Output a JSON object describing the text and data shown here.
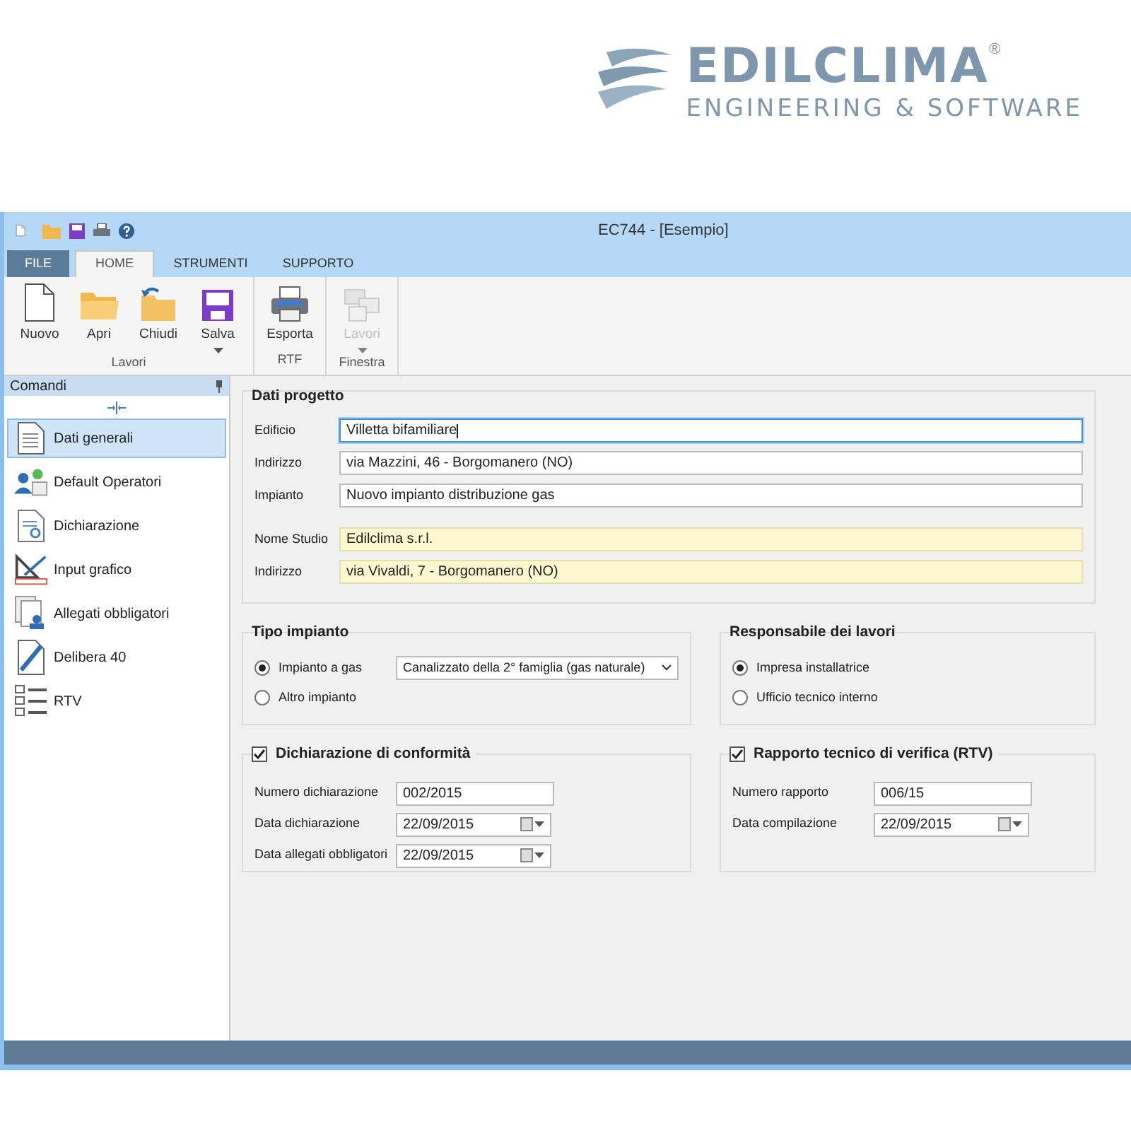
{
  "logo": {
    "name": "EDILCLIMA",
    "mark": "®",
    "tagline": "ENGINEERING & SOFTWARE"
  },
  "window": {
    "title": "EC744 - [Esempio]"
  },
  "ribbon_tabs": [
    {
      "label": "FILE",
      "kind": "file",
      "selected": false
    },
    {
      "label": "HOME",
      "kind": "tab",
      "selected": true
    },
    {
      "label": "STRUMENTI",
      "kind": "tab",
      "selected": false
    },
    {
      "label": "SUPPORTO",
      "kind": "tab",
      "selected": false
    }
  ],
  "ribbon_groups": [
    {
      "label": "Lavori",
      "buttons": [
        {
          "label": "Nuovo",
          "disabled": false,
          "dropdown": false
        },
        {
          "label": "Apri",
          "disabled": false,
          "dropdown": false
        },
        {
          "label": "Chiudi",
          "disabled": false,
          "dropdown": false
        },
        {
          "label": "Salva",
          "disabled": false,
          "dropdown": true
        }
      ]
    },
    {
      "label": "RTF",
      "buttons": [
        {
          "label": "Esporta",
          "disabled": false,
          "dropdown": false
        }
      ]
    },
    {
      "label": "Finestra",
      "buttons": [
        {
          "label": "Lavori",
          "disabled": true,
          "dropdown": true
        }
      ]
    }
  ],
  "sidebar": {
    "title": "Comandi",
    "items": [
      {
        "label": "Dati generali",
        "selected": true
      },
      {
        "label": "Default Operatori",
        "selected": false
      },
      {
        "label": "Dichiarazione",
        "selected": false
      },
      {
        "label": "Input grafico",
        "selected": false
      },
      {
        "label": "Allegati obbligatori",
        "selected": false
      },
      {
        "label": "Delibera 40",
        "selected": false
      },
      {
        "label": "RTV",
        "selected": false
      }
    ]
  },
  "dati_progetto": {
    "title": "Dati progetto",
    "fields": [
      {
        "label": "Edificio",
        "value": "Villetta bifamiliare",
        "kind": "plain",
        "focused": true
      },
      {
        "label": "Indirizzo",
        "value": "via Mazzini, 46 - Borgomanero (NO)",
        "kind": "plain",
        "focused": false
      },
      {
        "label": "Impianto",
        "value": "Nuovo impianto distribuzione gas",
        "kind": "plain",
        "focused": false
      },
      {
        "label": "Nome Studio",
        "value": "Edilclima s.r.l.",
        "kind": "studio",
        "focused": false
      },
      {
        "label": "Indirizzo",
        "value": "via Vivaldi, 7 - Borgomanero (NO)",
        "kind": "studio",
        "focused": false
      }
    ]
  },
  "tipo_impianto": {
    "title": "Tipo impianto",
    "options": [
      {
        "label": "Impianto a gas",
        "selected": true
      },
      {
        "label": "Altro impianto",
        "selected": false
      }
    ],
    "dropdown_value": "Canalizzato della 2° famiglia (gas naturale)"
  },
  "responsabile": {
    "title": "Responsabile dei lavori",
    "options": [
      {
        "label": "Impresa installatrice",
        "selected": true
      },
      {
        "label": "Ufficio tecnico interno",
        "selected": false
      }
    ]
  },
  "dichiarazione": {
    "title": "Dichiarazione di conformità",
    "checked": true,
    "fields": [
      {
        "label": "Numero dichiarazione",
        "value": "002/2015",
        "kind": "text"
      },
      {
        "label": "Data dichiarazione",
        "value": "22/09/2015",
        "kind": "date"
      },
      {
        "label": "Data allegati obbligatori",
        "value": "22/09/2015",
        "kind": "date"
      }
    ]
  },
  "rapporto": {
    "title": "Rapporto tecnico di verifica (RTV)",
    "checked": true,
    "fields": [
      {
        "label": "Numero rapporto",
        "value": "006/15",
        "kind": "text"
      },
      {
        "label": "Data compilazione",
        "value": "22/09/2015",
        "kind": "date"
      }
    ]
  }
}
